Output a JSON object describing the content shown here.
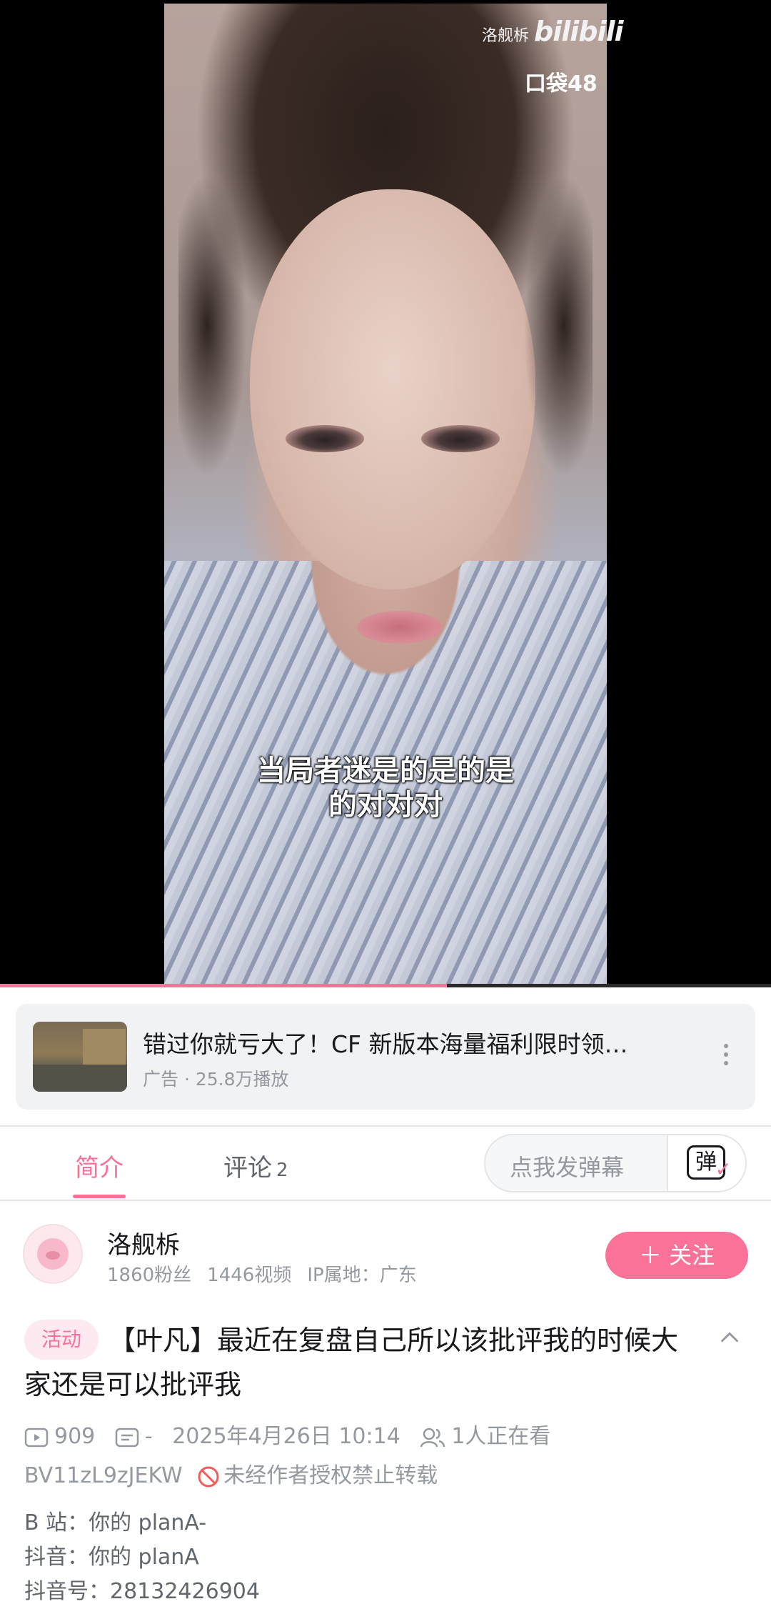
{
  "player": {
    "watermark_name": "洛舰柝",
    "watermark_logo": "bilibili",
    "watermark_pocket": "口袋48",
    "subtitle_line1": "当局者迷是的是的是",
    "subtitle_line2": "的对对对",
    "progress_fraction": 0.58
  },
  "ad": {
    "title": "错过你就亏大了！CF 新版本海量福利限时领…",
    "meta": "广告 · 25.8万播放"
  },
  "tabs": {
    "intro_label": "简介",
    "comments_label": "评论",
    "comments_count": "2",
    "danmu_placeholder": "点我发弹幕",
    "danmu_icon_char": "弹"
  },
  "uploader": {
    "name": "洛舰柝",
    "fans": "1860粉丝",
    "videos": "1446视频",
    "ip": "IP属地：广东",
    "follow_label": "＋ 关注"
  },
  "video": {
    "tag": "活动",
    "title": "【叶凡】最近在复盘自己所以该批评我的时候大家还是可以批评我",
    "plays": "909",
    "danmaku": "-",
    "date": "2025年4月26日 10:14",
    "watching": "1人正在看",
    "bvid": "BV11zL9zJEKW",
    "copyright": "未经作者授权禁止转载",
    "desc_line1": "B 站：你的 planA-",
    "desc_line2": "抖音：你的 planA",
    "desc_line3": "抖音号：28132426904"
  },
  "colors": {
    "accent": "#fb7299",
    "muted": "#9499a0"
  },
  "icons": [
    "play-count-icon",
    "danmaku-count-icon",
    "watching-icon",
    "no-repost-icon",
    "collapse-chevron-icon",
    "more-dots-icon",
    "danmu-toggle-icon"
  ]
}
